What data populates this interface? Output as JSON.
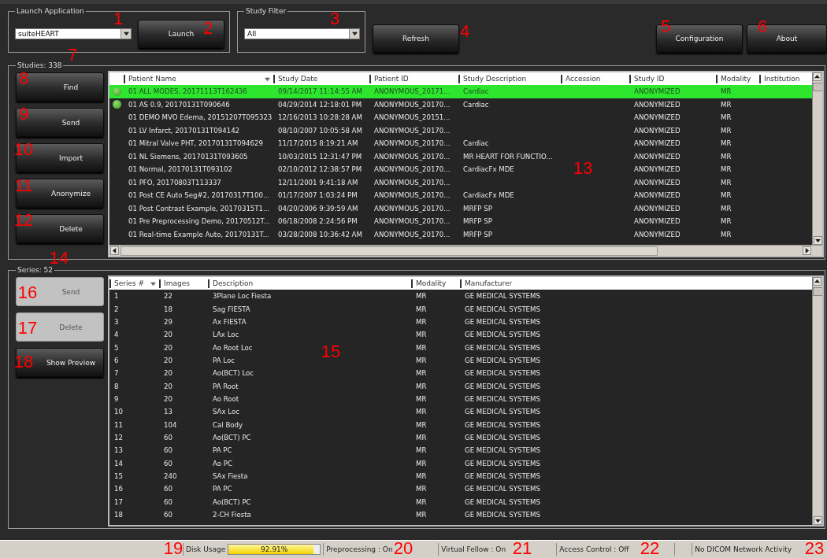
{
  "launch_application": {
    "title": "Launch Application",
    "combo": {
      "value": "suiteHEART"
    },
    "button": "Launch"
  },
  "study_filter": {
    "title": "Study Filter",
    "combo": {
      "value": "All"
    }
  },
  "refresh_button": "Refresh",
  "right_buttons": [
    "Configuration",
    "About"
  ],
  "studies": {
    "title": "Studies: 338",
    "buttons": [
      {
        "label": "Find",
        "disabled": false
      },
      {
        "label": "Send",
        "disabled": false
      },
      {
        "label": "Import",
        "disabled": false
      },
      {
        "label": "Anonymize",
        "disabled": false
      },
      {
        "label": "Delete",
        "disabled": false
      }
    ],
    "columns": [
      {
        "label": "Patient Name",
        "sorted": true
      },
      {
        "label": "Study Date",
        "sorted": false
      },
      {
        "label": "Patient ID",
        "sorted": false
      },
      {
        "label": "Study Description",
        "sorted": false
      },
      {
        "label": "Accession",
        "sorted": false
      },
      {
        "label": "Study ID",
        "sorted": false
      },
      {
        "label": "Modality",
        "sorted": false
      },
      {
        "label": "Institution",
        "sorted": false
      }
    ],
    "rows": [
      {
        "indicator": true,
        "selected": true,
        "patient_name": "01 ALL MODES, 20171113T162436",
        "study_date": "09/14/2017 11:14:55 AM",
        "patient_id": "ANONYMOUS_20171...",
        "study_description": "Cardiac",
        "study_id": "ANONYMIZED",
        "modality": "MR"
      },
      {
        "indicator": true,
        "selected": false,
        "patient_name": "01 AS 0.9, 20170131T090646",
        "study_date": "04/29/2014 12:18:01 PM",
        "patient_id": "ANONYMOUS_20170...",
        "study_description": "Cardiac",
        "study_id": "ANONYMIZED",
        "modality": "MR"
      },
      {
        "indicator": false,
        "selected": false,
        "patient_name": "01 DEMO MVO Edema, 20151207T095323",
        "study_date": "12/16/2013 10:28:28 AM",
        "patient_id": "ANONYMOUS_20151...",
        "study_id": "ANONYMIZED",
        "modality": "MR"
      },
      {
        "indicator": false,
        "selected": false,
        "patient_name": "01 LV Infarct, 20170131T094142",
        "study_date": "08/10/2007 10:05:58 AM",
        "patient_id": "ANONYMOUS_20170...",
        "study_id": "ANONYMIZED",
        "modality": "MR"
      },
      {
        "indicator": false,
        "selected": false,
        "patient_name": "01 Mitral Valve PHT, 20170131T094629",
        "study_date": "11/17/2015 8:19:21 AM",
        "patient_id": "ANONYMOUS_20170...",
        "study_description": "Cardiac",
        "study_id": "ANONYMIZED",
        "modality": "MR"
      },
      {
        "indicator": false,
        "selected": false,
        "patient_name": "01 NL Siemens, 20170131T093605",
        "study_date": "10/03/2015 12:31:47 PM",
        "patient_id": "ANONYMOUS_20170...",
        "study_description": "MR HEART FOR FUNCTIO...",
        "study_id": "ANONYMIZED",
        "modality": "MR"
      },
      {
        "indicator": false,
        "selected": false,
        "patient_name": "01 Normal, 20170131T093102",
        "study_date": "02/10/2012 12:38:57 PM",
        "patient_id": "ANONYMOUS_20170...",
        "study_description": "CardiacFx MDE",
        "study_id": "ANONYMIZED",
        "modality": "MR"
      },
      {
        "indicator": false,
        "selected": false,
        "patient_name": "01 PFO, 20170803T113337",
        "study_date": "12/11/2001 9:41:18 AM",
        "patient_id": "ANONYMOUS_20170...",
        "study_id": "ANONYMIZED",
        "modality": "MR"
      },
      {
        "indicator": false,
        "selected": false,
        "patient_name": "01 Post CE Auto Seg#2, 20170317T100...",
        "study_date": "01/17/2007 1:03:24 PM",
        "patient_id": "ANONYMOUS_20170...",
        "study_description": "CardiacFx MDE",
        "study_id": "ANONYMIZED",
        "modality": "MR"
      },
      {
        "indicator": false,
        "selected": false,
        "patient_name": "01 Post Contrast Example, 20170315T1...",
        "study_date": "04/20/2006 9:39:59 AM",
        "patient_id": "ANONYMOUS_20170...",
        "study_description": "MRFP SP",
        "study_id": "ANONYMIZED",
        "modality": "MR"
      },
      {
        "indicator": false,
        "selected": false,
        "patient_name": "01 Pre Preprocessing Demo, 20170512T...",
        "study_date": "06/18/2008 2:24:56 PM",
        "patient_id": "ANONYMOUS_20170...",
        "study_description": "MRFP SP",
        "study_id": "ANONYMIZED",
        "modality": "MR"
      },
      {
        "indicator": false,
        "selected": false,
        "patient_name": "01 Real-time Example Auto, 20170131T...",
        "study_date": "03/28/2008 10:36:42 AM",
        "patient_id": "ANONYMOUS_20170...",
        "study_description": "MRFP SP",
        "study_id": "ANONYMIZED",
        "modality": "MR"
      }
    ]
  },
  "series": {
    "title": "Series: 52",
    "buttons": [
      {
        "label": "Send",
        "disabled": true
      },
      {
        "label": "Delete",
        "disabled": true
      },
      {
        "label": "Show Preview",
        "disabled": false
      }
    ],
    "columns": [
      {
        "label": "Series #",
        "sorted": true
      },
      {
        "label": "Images",
        "sorted": false
      },
      {
        "label": "Description",
        "sorted": false
      },
      {
        "label": "Modality",
        "sorted": false
      },
      {
        "label": "Manufacturer",
        "sorted": false
      }
    ],
    "rows": [
      {
        "series_no": "1",
        "images": "22",
        "description": "3Plane Loc Fiesta",
        "modality": "MR",
        "manufacturer": "GE MEDICAL SYSTEMS"
      },
      {
        "series_no": "2",
        "images": "18",
        "description": "Sag FIESTA",
        "modality": "MR",
        "manufacturer": "GE MEDICAL SYSTEMS"
      },
      {
        "series_no": "3",
        "images": "29",
        "description": "Ax FIESTA",
        "modality": "MR",
        "manufacturer": "GE MEDICAL SYSTEMS"
      },
      {
        "series_no": "4",
        "images": "20",
        "description": "LAx Loc",
        "modality": "MR",
        "manufacturer": "GE MEDICAL SYSTEMS"
      },
      {
        "series_no": "5",
        "images": "20",
        "description": "Ao Root Loc",
        "modality": "MR",
        "manufacturer": "GE MEDICAL SYSTEMS"
      },
      {
        "series_no": "6",
        "images": "20",
        "description": "PA  Loc",
        "modality": "MR",
        "manufacturer": "GE MEDICAL SYSTEMS"
      },
      {
        "series_no": "7",
        "images": "20",
        "description": "Ao(BCT) Loc",
        "modality": "MR",
        "manufacturer": "GE MEDICAL SYSTEMS"
      },
      {
        "series_no": "8",
        "images": "20",
        "description": "PA Root",
        "modality": "MR",
        "manufacturer": "GE MEDICAL SYSTEMS"
      },
      {
        "series_no": "9",
        "images": "20",
        "description": "Ao Root",
        "modality": "MR",
        "manufacturer": "GE MEDICAL SYSTEMS"
      },
      {
        "series_no": "10",
        "images": "13",
        "description": "SAx Loc",
        "modality": "MR",
        "manufacturer": "GE MEDICAL SYSTEMS"
      },
      {
        "series_no": "11",
        "images": "104",
        "description": "Cal Body",
        "modality": "MR",
        "manufacturer": "GE MEDICAL SYSTEMS"
      },
      {
        "series_no": "12",
        "images": "60",
        "description": "Ao(BCT) PC",
        "modality": "MR",
        "manufacturer": "GE MEDICAL SYSTEMS"
      },
      {
        "series_no": "13",
        "images": "60",
        "description": "PA PC",
        "modality": "MR",
        "manufacturer": "GE MEDICAL SYSTEMS"
      },
      {
        "series_no": "14",
        "images": "60",
        "description": "Ao PC",
        "modality": "MR",
        "manufacturer": "GE MEDICAL SYSTEMS"
      },
      {
        "series_no": "15",
        "images": "240",
        "description": "SAx Fiesta",
        "modality": "MR",
        "manufacturer": "GE MEDICAL SYSTEMS"
      },
      {
        "series_no": "16",
        "images": "60",
        "description": "PA PC",
        "modality": "MR",
        "manufacturer": "GE MEDICAL SYSTEMS"
      },
      {
        "series_no": "17",
        "images": "60",
        "description": "Ao(BCT) PC",
        "modality": "MR",
        "manufacturer": "GE MEDICAL SYSTEMS"
      },
      {
        "series_no": "18",
        "images": "60",
        "description": "2-CH Fiesta",
        "modality": "MR",
        "manufacturer": "GE MEDICAL SYSTEMS"
      }
    ]
  },
  "status_bar": {
    "disk_usage": {
      "label": "Disk Usage",
      "level": 0.9291,
      "reading": "92.91%"
    },
    "fields": [
      "Preprocessing : On",
      "Virtual Fellow : On",
      "Access Control : Off",
      "No DICOM Network Activity"
    ]
  },
  "callouts": [
    "1",
    "2",
    "3",
    "4",
    "5",
    "6",
    "7",
    "8",
    "9",
    "10",
    "11",
    "12",
    "13",
    "14",
    "15",
    "16",
    "17",
    "18",
    "19",
    "20",
    "21",
    "22",
    "23"
  ]
}
